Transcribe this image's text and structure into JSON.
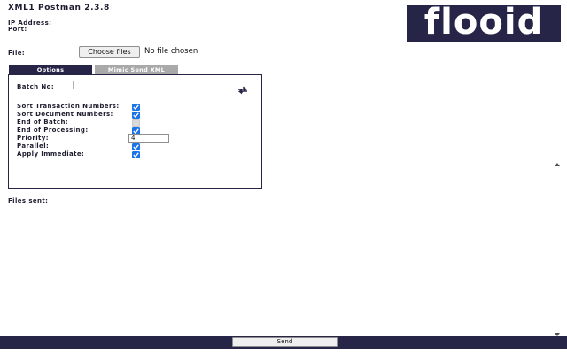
{
  "app": {
    "title": "XML1 Postman 2.3.8",
    "logo_text": "flooid",
    "brand_color": "#262447"
  },
  "connection": {
    "ip_label": "IP Address:",
    "port_label": "Port:"
  },
  "file": {
    "label": "File:",
    "choose_button": "Choose files",
    "status": "No file chosen"
  },
  "tabs": [
    {
      "label": "Options",
      "active": true
    },
    {
      "label": "Mimic Send XML",
      "active": false
    }
  ],
  "options": {
    "batch_label": "Batch No:",
    "batch_value": "",
    "refresh_icon": "refresh-arrows-icon",
    "items": [
      {
        "label": "Sort Transaction Numbers:",
        "checked": true,
        "disabled": false
      },
      {
        "label": "Sort Document Numbers:",
        "checked": true,
        "disabled": false
      },
      {
        "label": "End of Batch:",
        "checked": false,
        "disabled": true
      },
      {
        "label": "End of Processing:",
        "checked": true,
        "disabled": false
      },
      {
        "label": "Priority:",
        "value": "4"
      },
      {
        "label": "Parallel:",
        "checked": true,
        "disabled": false
      },
      {
        "label": "Apply Immediate:",
        "checked": true,
        "disabled": false
      }
    ]
  },
  "files_sent": {
    "label": "Files sent:"
  },
  "footer": {
    "send_button": "Send"
  }
}
